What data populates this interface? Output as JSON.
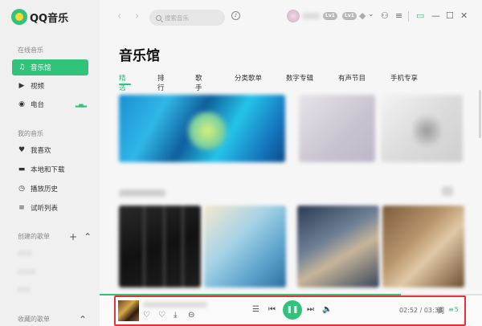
{
  "app": {
    "logo_text": "QQ音乐"
  },
  "sidebar": {
    "online_section": "在线音乐",
    "online_items": [
      {
        "label": "音乐馆",
        "icon": "music-note-icon",
        "active": true
      },
      {
        "label": "视频",
        "icon": "video-icon",
        "active": false
      },
      {
        "label": "电台",
        "icon": "radio-icon",
        "active": false
      }
    ],
    "my_section": "我的音乐",
    "my_items": [
      {
        "label": "我喜欢",
        "icon": "heart-icon"
      },
      {
        "label": "本地和下载",
        "icon": "monitor-icon"
      },
      {
        "label": "播放历史",
        "icon": "clock-icon"
      },
      {
        "label": "试听列表",
        "icon": "list-icon"
      }
    ],
    "created_section": "创建的歌单",
    "collected_section": "收藏的歌单"
  },
  "header": {
    "search_placeholder": "搜索音乐",
    "badges": [
      "Lv1",
      "Lv1"
    ]
  },
  "main": {
    "title": "音乐馆",
    "tabs": [
      "精选",
      "排行",
      "歌手",
      "分类歌单",
      "数字专辑",
      "有声节目",
      "手机专享"
    ],
    "active_tab": "精选"
  },
  "player": {
    "current_time": "02:52",
    "total_time": "03:38",
    "time_display": "02:52 / 03:38",
    "lyrics_label": "词",
    "playlist_count": "5",
    "progress_fraction": 0.787
  },
  "colors": {
    "accent": "#31c27c",
    "highlight_border": "#e2333b"
  }
}
